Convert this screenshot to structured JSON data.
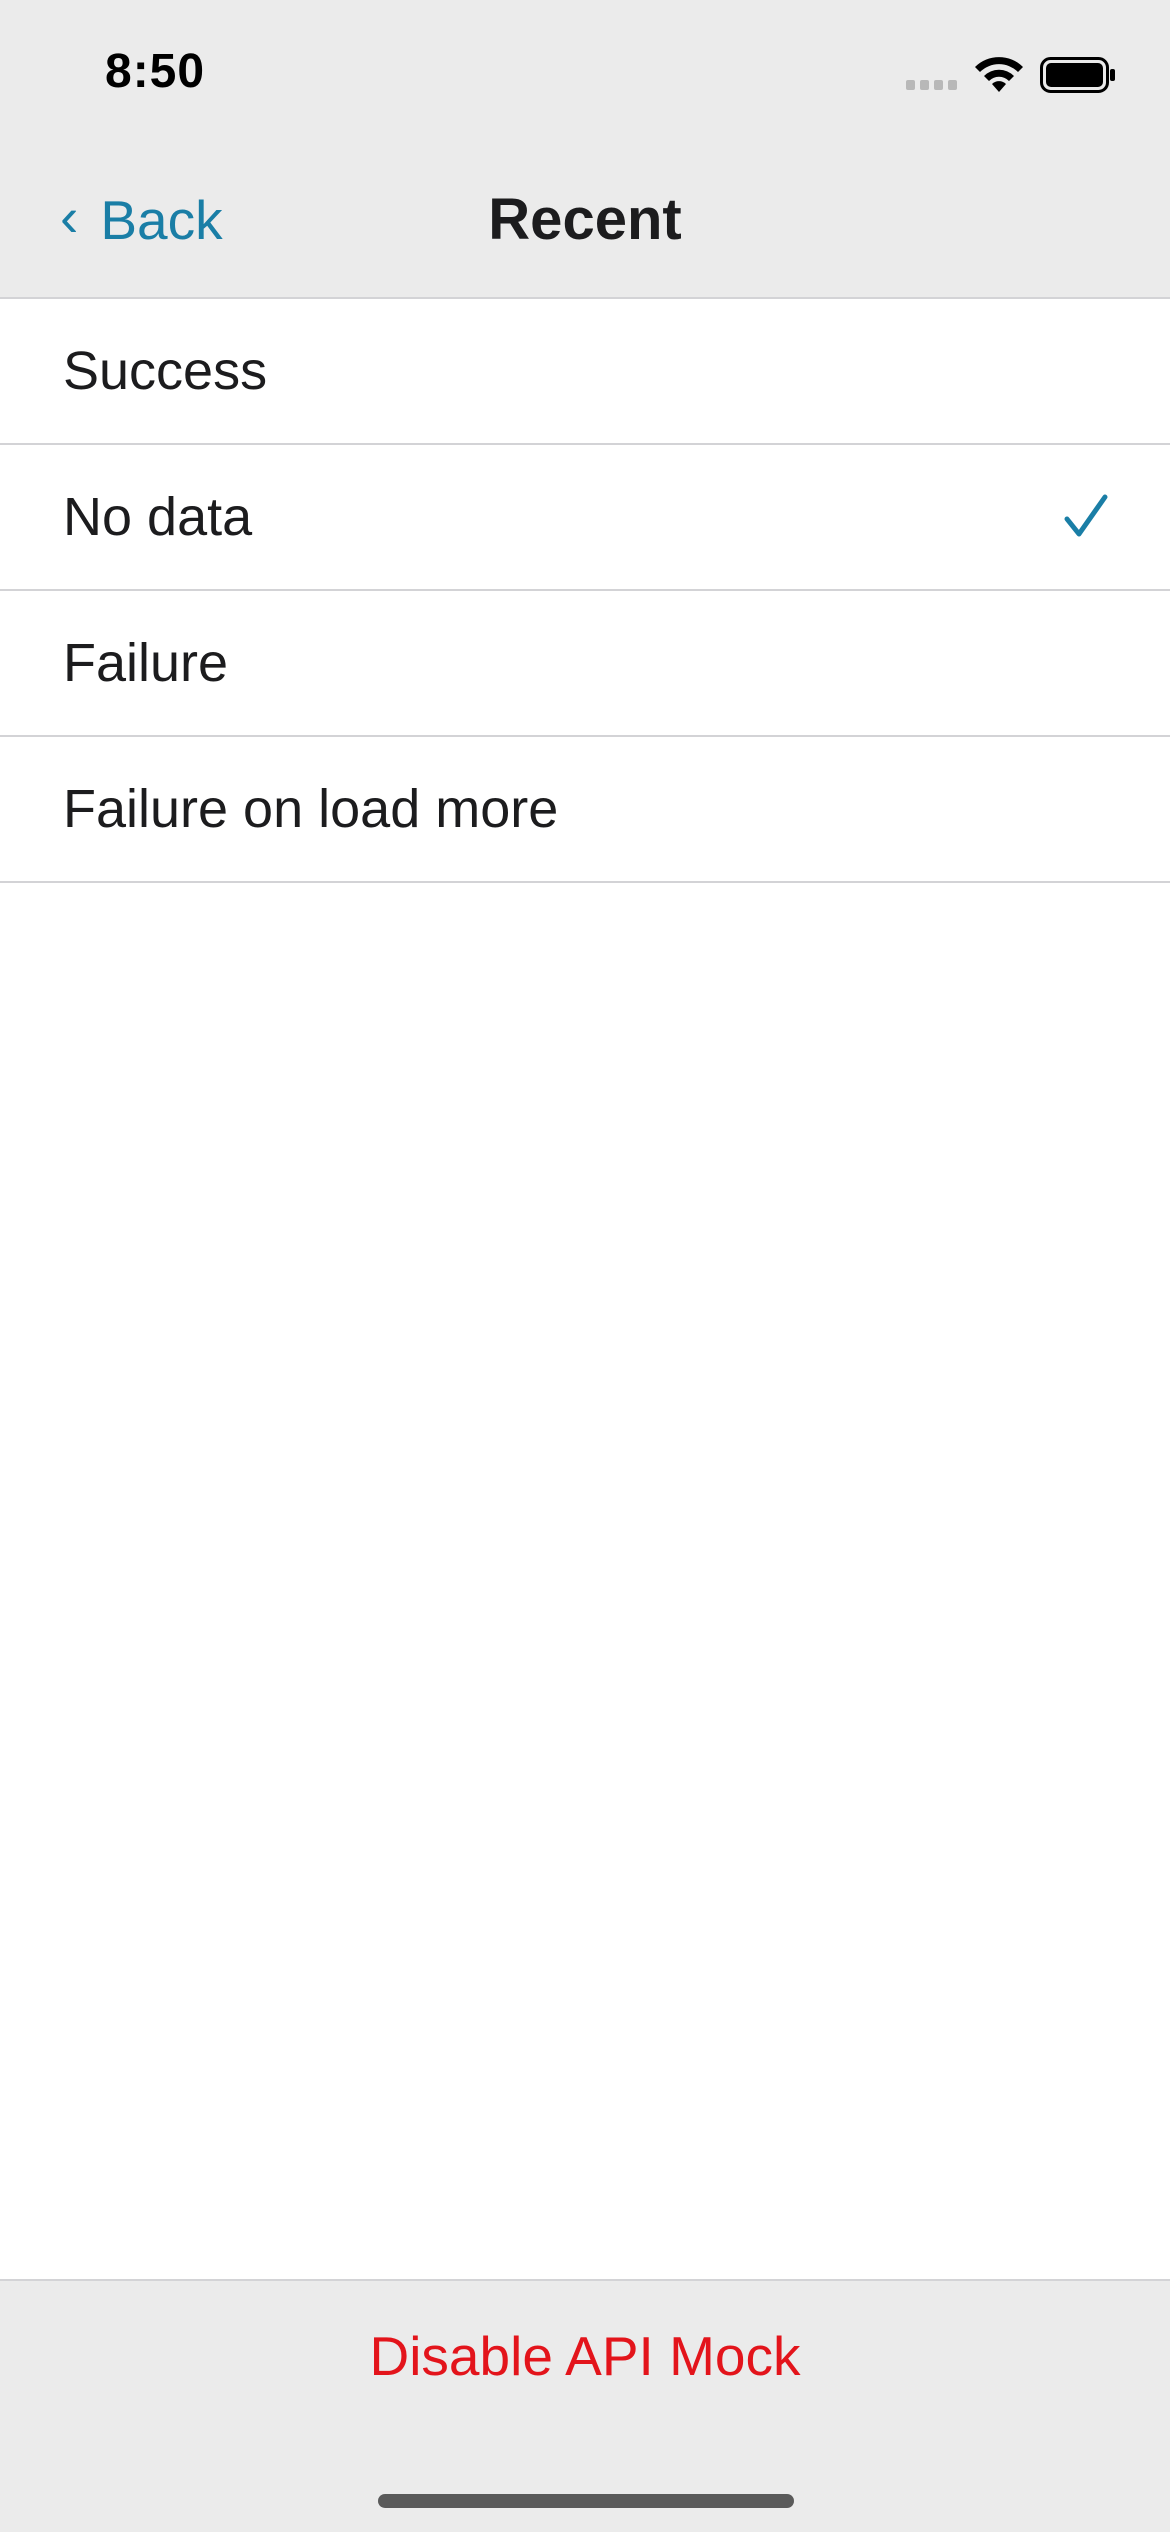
{
  "status_bar": {
    "time": "8:50",
    "icons": [
      "signal-icon",
      "wifi-icon",
      "battery-icon"
    ]
  },
  "nav": {
    "back_label": "Back",
    "back_icon": "chevron-left-icon",
    "title": "Recent"
  },
  "options": [
    {
      "label": "Success",
      "selected": false
    },
    {
      "label": "No data",
      "selected": true
    },
    {
      "label": "Failure",
      "selected": false
    },
    {
      "label": "Failure on load more",
      "selected": false
    }
  ],
  "footer": {
    "disable_label": "Disable API Mock"
  },
  "colors": {
    "accent": "#1a7ea6",
    "destructive": "#e3141b",
    "bar_background": "#ebebeb",
    "separator": "#d3d3d6"
  }
}
